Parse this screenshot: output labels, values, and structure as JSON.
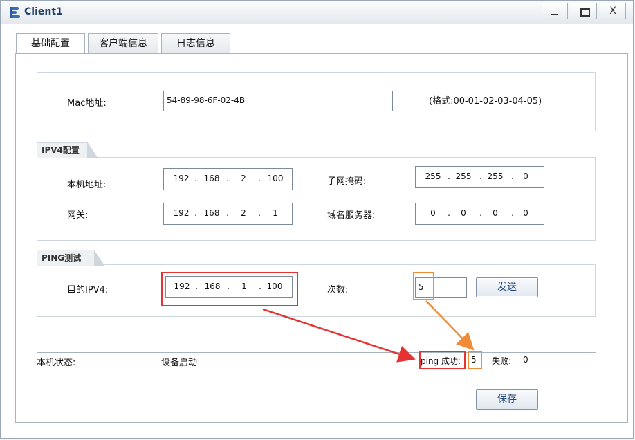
{
  "window": {
    "title": "Client1"
  },
  "titlebar": {
    "close_glyph": "X"
  },
  "tabs": [
    {
      "label": "基础配置",
      "active": true
    },
    {
      "label": "客户端信息",
      "active": false
    },
    {
      "label": "日志信息",
      "active": false
    }
  ],
  "mac": {
    "label": "Mac地址:",
    "value": "54-89-98-6F-02-4B",
    "format_hint": "(格式:00-01-02-03-04-05)"
  },
  "ipv4": {
    "section_label": "IPV4配置",
    "local_label": "本机地址:",
    "local_ip": [
      "192",
      "168",
      "2",
      "100"
    ],
    "subnet_label": "子网掩码:",
    "subnet": [
      "255",
      "255",
      "255",
      "0"
    ],
    "gateway_label": "网关:",
    "gateway": [
      "192",
      "168",
      "2",
      "1"
    ],
    "dns_label": "域名服务器:",
    "dns": [
      "0",
      "0",
      "0",
      "0"
    ]
  },
  "ping": {
    "section_label": "PING测试",
    "dest_label": "目的IPV4:",
    "dest_ip": [
      "192",
      "168",
      "1",
      "100"
    ],
    "count_label": "次数:",
    "count_value": "5",
    "send_label": "发送"
  },
  "status": {
    "label": "本机状态:",
    "value": "设备启动",
    "ping_success_label": "ping 成功:",
    "ping_success_value": "5",
    "fail_label": "失败:",
    "fail_value": "0"
  },
  "save_label": "保存",
  "colors": {
    "highlight_red": "#e53333",
    "highlight_orange": "#f08c38",
    "title_text": "#1f3d66"
  }
}
